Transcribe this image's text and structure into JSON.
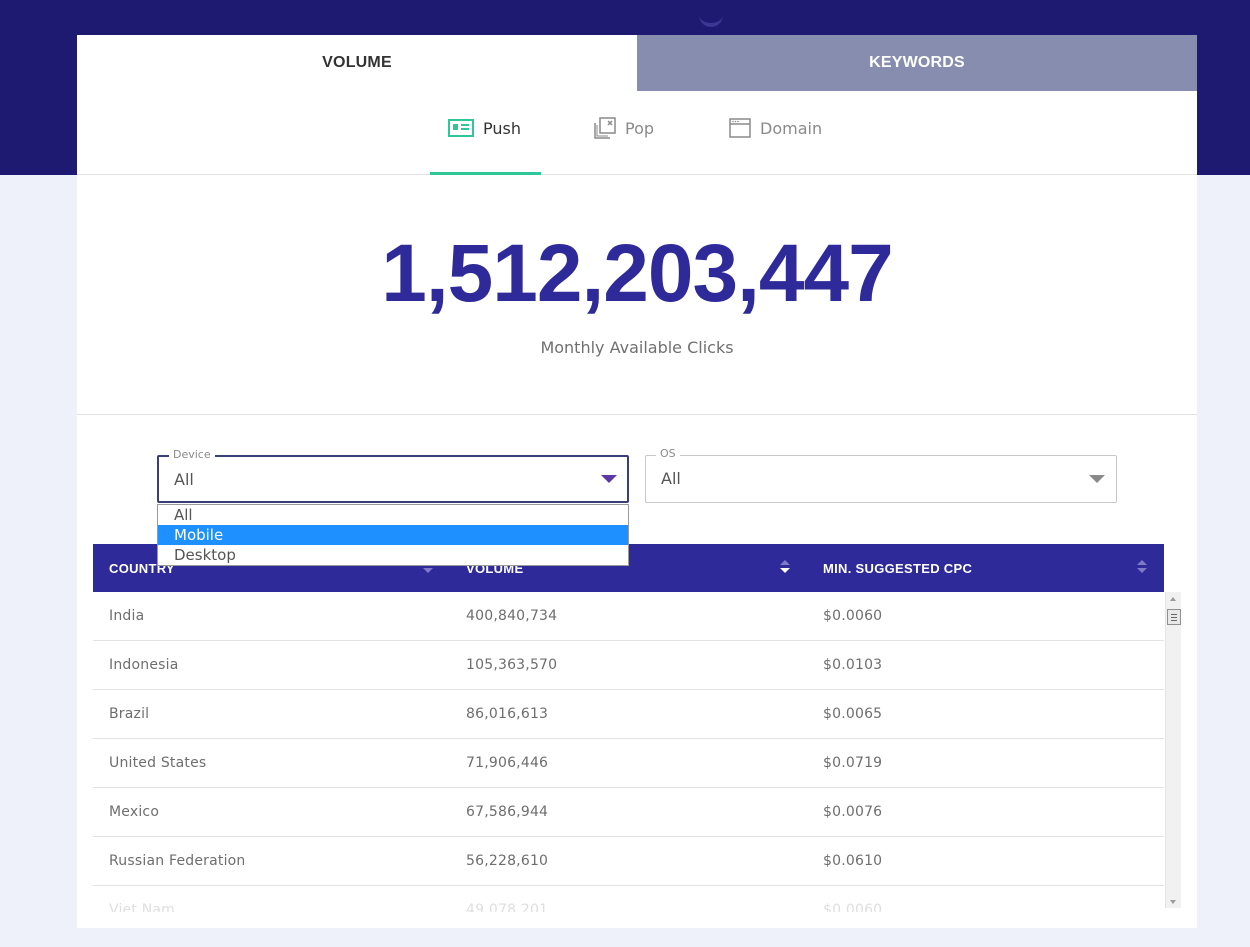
{
  "main_tabs": [
    {
      "label": "VOLUME",
      "active": true
    },
    {
      "label": "KEYWORDS",
      "active": false
    }
  ],
  "sub_tabs": [
    {
      "label": "Push",
      "icon": "push-card-icon",
      "active": true
    },
    {
      "label": "Pop",
      "icon": "pop-window-icon",
      "active": false
    },
    {
      "label": "Domain",
      "icon": "browser-window-icon",
      "active": false
    }
  ],
  "summary": {
    "value": "1,512,203,447",
    "caption": "Monthly Available Clicks"
  },
  "filters": {
    "device": {
      "legend": "Device",
      "value": "All",
      "options": [
        "All",
        "Mobile",
        "Desktop"
      ],
      "highlighted": "Mobile"
    },
    "os": {
      "legend": "OS",
      "value": "All"
    }
  },
  "table": {
    "columns": [
      "COUNTRY",
      "VOLUME",
      "MIN. SUGGESTED CPC"
    ],
    "sorted_by": "VOLUME",
    "rows": [
      [
        "India",
        "400,840,734",
        "$0.0060"
      ],
      [
        "Indonesia",
        "105,363,570",
        "$0.0103"
      ],
      [
        "Brazil",
        "86,016,613",
        "$0.0065"
      ],
      [
        "United States",
        "71,906,446",
        "$0.0719"
      ],
      [
        "Mexico",
        "67,586,944",
        "$0.0076"
      ],
      [
        "Russian Federation",
        "56,228,610",
        "$0.0610"
      ],
      [
        "Viet Nam",
        "49,078,201",
        "$0.0060"
      ]
    ]
  },
  "colors": {
    "header_band": "#1e1a72",
    "accent_purple": "#2e2a9a",
    "inactive_tab": "#868daf",
    "active_underline": "#2dc79a",
    "option_highlight": "#1e90ff"
  }
}
